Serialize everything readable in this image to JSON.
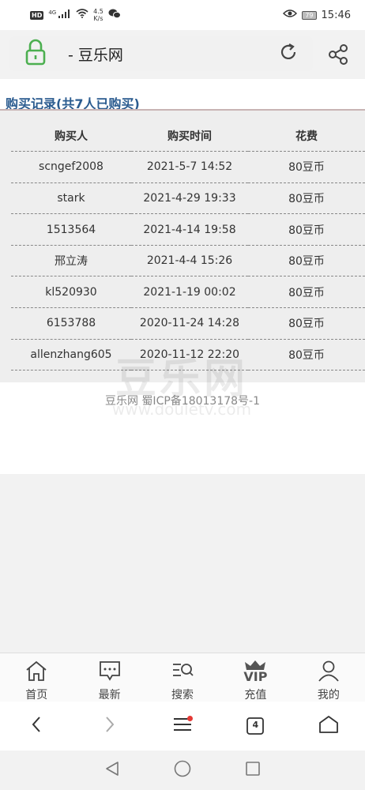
{
  "status_bar": {
    "badge": "HD",
    "network": "4G",
    "speed_value": "4.5",
    "speed_unit": "K/s",
    "battery": "79",
    "time": "15:46"
  },
  "address_bar": {
    "text": "- 豆乐网"
  },
  "page": {
    "title": "购买记录(共7人已购买)",
    "columns": [
      "购买人",
      "购买时间",
      "花费"
    ],
    "rows": [
      {
        "buyer": "scngef2008",
        "time": "2021-5-7 14:52",
        "cost": "80豆币"
      },
      {
        "buyer": "stark",
        "time": "2021-4-29 19:33",
        "cost": "80豆币"
      },
      {
        "buyer": "1513564",
        "time": "2021-4-14 19:58",
        "cost": "80豆币"
      },
      {
        "buyer": "邢立涛",
        "time": "2021-4-4 15:26",
        "cost": "80豆币"
      },
      {
        "buyer": "kl520930",
        "time": "2021-1-19 00:02",
        "cost": "80豆币"
      },
      {
        "buyer": "6153788",
        "time": "2020-11-24 14:28",
        "cost": "80豆币"
      },
      {
        "buyer": "allenzhang605",
        "time": "2020-11-12 22:20",
        "cost": "80豆币"
      }
    ],
    "footer": "豆乐网 蜀ICP备18013178号-1",
    "watermark_big": "豆乐网",
    "watermark_small": "www.douletv.com"
  },
  "bottom_nav": {
    "items": [
      {
        "label": "首页",
        "icon": "home-icon"
      },
      {
        "label": "最新",
        "icon": "message-icon"
      },
      {
        "label": "搜索",
        "icon": "search-list-icon"
      },
      {
        "label": "充值",
        "icon": "vip-crown-icon",
        "badge": "VIP"
      },
      {
        "label": "我的",
        "icon": "user-icon"
      }
    ]
  },
  "browser_bar": {
    "tab_count": "4"
  },
  "colors": {
    "title": "#2a5b8f",
    "lock": "#4caf50",
    "notification_dot": "#e53935"
  }
}
